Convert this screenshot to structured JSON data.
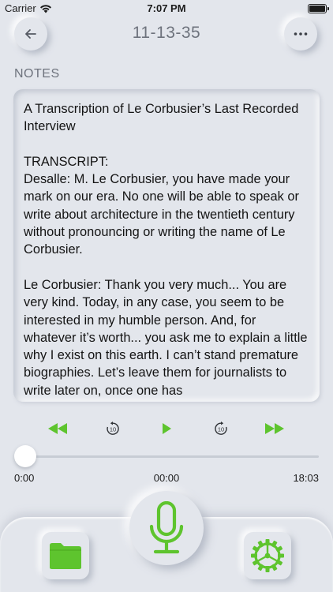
{
  "status_bar": {
    "carrier": "Carrier",
    "time": "7:07 PM",
    "icons": [
      "wifi-icon",
      "battery-icon"
    ]
  },
  "header": {
    "title": "11-13-35",
    "back_icon": "arrow-left-icon",
    "more_icon": "ellipsis-icon"
  },
  "notes": {
    "label": "NOTES",
    "text": "A Transcription of Le Corbusier’s Last Recorded Interview\n\nTRANSCRIPT:\nDesalle: M. Le Corbusier, you have made your mark on our era. No one will be able to speak or write about architecture in the twentieth century without pronouncing or writing the name of Le Corbusier.\n\nLe Corbusier: Thank you very much... You are very kind. Today, in any case, you seem to be interested in my humble person. And, for whatever it’s worth... you ask me to explain a little why I exist on this earth. I can’t stand premature biographies. Let’s leave them for journalists to write later on, once one has"
  },
  "player": {
    "controls": [
      "rewind-icon",
      "skip-back-10-icon",
      "play-icon",
      "skip-forward-10-icon",
      "fast-forward-icon"
    ],
    "skip_seconds": "10",
    "position_fraction": 0,
    "elapsed": "0:00",
    "current": "00:00",
    "duration": "18:03"
  },
  "bottom_bar": {
    "icons": [
      "folder-icon",
      "microphone-icon",
      "settings-gear-icon"
    ]
  },
  "colors": {
    "background": "#e3e6ec",
    "accent_green": "#5ec42e",
    "muted_text": "#6e737d"
  }
}
